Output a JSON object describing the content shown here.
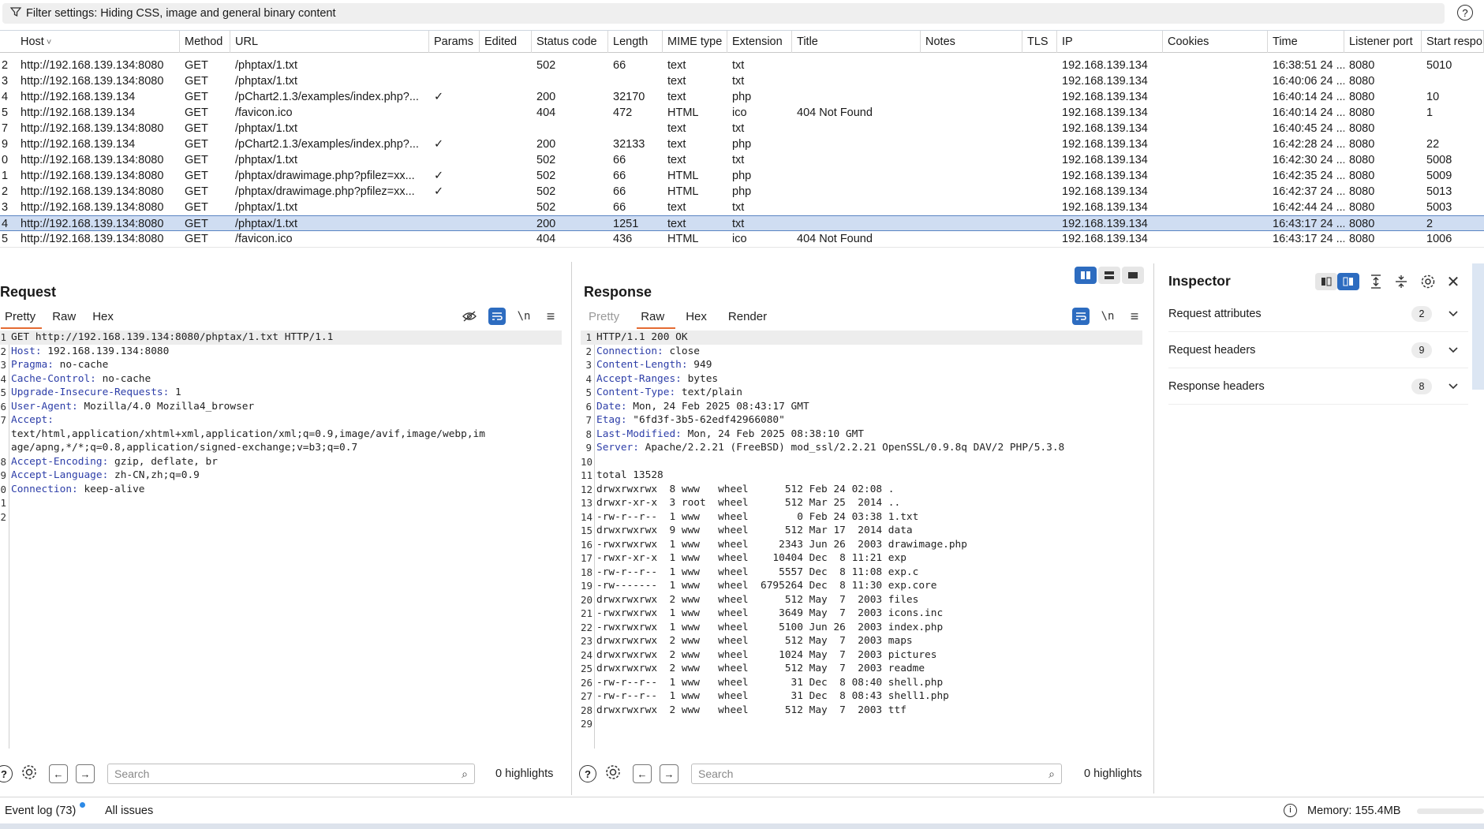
{
  "filter": {
    "text": "Filter settings: Hiding CSS, image and general binary content"
  },
  "table": {
    "columns": [
      {
        "label": "Host",
        "sort": "˅"
      },
      {
        "label": "Method"
      },
      {
        "label": "URL"
      },
      {
        "label": "Params"
      },
      {
        "label": "Edited"
      },
      {
        "label": "Status code"
      },
      {
        "label": "Length"
      },
      {
        "label": "MIME type"
      },
      {
        "label": "Extension"
      },
      {
        "label": "Title"
      },
      {
        "label": "Notes"
      },
      {
        "label": "TLS"
      },
      {
        "label": "IP"
      },
      {
        "label": "Cookies"
      },
      {
        "label": "Time"
      },
      {
        "label": "Listener port"
      },
      {
        "label": "Start respo"
      }
    ],
    "rows": [
      {
        "num": "2",
        "host": "http://192.168.139.134:8080",
        "method": "GET",
        "url": "/phptax/1.txt",
        "params": "",
        "status": "502",
        "length": "66",
        "mime": "text",
        "ext": "txt",
        "title": "",
        "ip": "192.168.139.134",
        "time": "16:38:51 24 ...",
        "port": "8080",
        "start": "5010",
        "selected": false
      },
      {
        "num": "3",
        "host": "http://192.168.139.134:8080",
        "method": "GET",
        "url": "/phptax/1.txt",
        "params": "",
        "status": "",
        "length": "",
        "mime": "text",
        "ext": "txt",
        "title": "",
        "ip": "192.168.139.134",
        "time": "16:40:06 24 ...",
        "port": "8080",
        "start": "",
        "selected": false
      },
      {
        "num": "4",
        "host": "http://192.168.139.134",
        "method": "GET",
        "url": "/pChart2.1.3/examples/index.php?...",
        "params": "✓",
        "status": "200",
        "length": "32170",
        "mime": "text",
        "ext": "php",
        "title": "",
        "ip": "192.168.139.134",
        "time": "16:40:14 24 ...",
        "port": "8080",
        "start": "10",
        "selected": false
      },
      {
        "num": "5",
        "host": "http://192.168.139.134",
        "method": "GET",
        "url": "/favicon.ico",
        "params": "",
        "status": "404",
        "length": "472",
        "mime": "HTML",
        "ext": "ico",
        "title": "404 Not Found",
        "ip": "192.168.139.134",
        "time": "16:40:14 24 ...",
        "port": "8080",
        "start": "1",
        "selected": false
      },
      {
        "num": "7",
        "host": "http://192.168.139.134:8080",
        "method": "GET",
        "url": "/phptax/1.txt",
        "params": "",
        "status": "",
        "length": "",
        "mime": "text",
        "ext": "txt",
        "title": "",
        "ip": "192.168.139.134",
        "time": "16:40:45 24 ...",
        "port": "8080",
        "start": "",
        "selected": false
      },
      {
        "num": "9",
        "host": "http://192.168.139.134",
        "method": "GET",
        "url": "/pChart2.1.3/examples/index.php?...",
        "params": "✓",
        "status": "200",
        "length": "32133",
        "mime": "text",
        "ext": "php",
        "title": "",
        "ip": "192.168.139.134",
        "time": "16:42:28 24 ...",
        "port": "8080",
        "start": "22",
        "selected": false
      },
      {
        "num": "0",
        "host": "http://192.168.139.134:8080",
        "method": "GET",
        "url": "/phptax/1.txt",
        "params": "",
        "status": "502",
        "length": "66",
        "mime": "text",
        "ext": "txt",
        "title": "",
        "ip": "192.168.139.134",
        "time": "16:42:30 24 ...",
        "port": "8080",
        "start": "5008",
        "selected": false
      },
      {
        "num": "1",
        "host": "http://192.168.139.134:8080",
        "method": "GET",
        "url": "/phptax/drawimage.php?pfilez=xx...",
        "params": "✓",
        "status": "502",
        "length": "66",
        "mime": "HTML",
        "ext": "php",
        "title": "",
        "ip": "192.168.139.134",
        "time": "16:42:35 24 ...",
        "port": "8080",
        "start": "5009",
        "selected": false
      },
      {
        "num": "2",
        "host": "http://192.168.139.134:8080",
        "method": "GET",
        "url": "/phptax/drawimage.php?pfilez=xx...",
        "params": "✓",
        "status": "502",
        "length": "66",
        "mime": "HTML",
        "ext": "php",
        "title": "",
        "ip": "192.168.139.134",
        "time": "16:42:37 24 ...",
        "port": "8080",
        "start": "5013",
        "selected": false
      },
      {
        "num": "3",
        "host": "http://192.168.139.134:8080",
        "method": "GET",
        "url": "/phptax/1.txt",
        "params": "",
        "status": "502",
        "length": "66",
        "mime": "text",
        "ext": "txt",
        "title": "",
        "ip": "192.168.139.134",
        "time": "16:42:44 24 ...",
        "port": "8080",
        "start": "5003",
        "selected": false
      },
      {
        "num": "4",
        "host": "http://192.168.139.134:8080",
        "method": "GET",
        "url": "/phptax/1.txt",
        "params": "",
        "status": "200",
        "length": "1251",
        "mime": "text",
        "ext": "txt",
        "title": "",
        "ip": "192.168.139.134",
        "time": "16:43:17 24 ...",
        "port": "8080",
        "start": "2",
        "selected": true
      },
      {
        "num": "5",
        "host": "http://192.168.139.134:8080",
        "method": "GET",
        "url": "/favicon.ico",
        "params": "",
        "status": "404",
        "length": "436",
        "mime": "HTML",
        "ext": "ico",
        "title": "404 Not Found",
        "ip": "192.168.139.134",
        "time": "16:43:17 24 ...",
        "port": "8080",
        "start": "1006",
        "selected": false
      }
    ]
  },
  "request": {
    "title": "Request",
    "tabs": [
      "Pretty",
      "Raw",
      "Hex"
    ],
    "active_tab": "Pretty",
    "lines": [
      {
        "n": "1",
        "name": "",
        "value": "GET http://192.168.139.134:8080/phptax/1.txt HTTP/1.1"
      },
      {
        "n": "2",
        "name": "Host:",
        "value": " 192.168.139.134:8080"
      },
      {
        "n": "3",
        "name": "Pragma:",
        "value": " no-cache"
      },
      {
        "n": "4",
        "name": "Cache-Control:",
        "value": " no-cache"
      },
      {
        "n": "5",
        "name": "Upgrade-Insecure-Requests:",
        "value": " 1"
      },
      {
        "n": "6",
        "name": "User-Agent:",
        "value": " Mozilla/4.0 Mozilla4_browser"
      },
      {
        "n": "7",
        "name": "Accept:",
        "value": ""
      },
      {
        "n": "",
        "name": "",
        "value": "text/html,application/xhtml+xml,application/xml;q=0.9,image/avif,image/webp,im"
      },
      {
        "n": "",
        "name": "",
        "value": "age/apng,*/*;q=0.8,application/signed-exchange;v=b3;q=0.7"
      },
      {
        "n": "8",
        "name": "Accept-Encoding:",
        "value": " gzip, deflate, br"
      },
      {
        "n": "9",
        "name": "Accept-Language:",
        "value": " zh-CN,zh;q=0.9"
      },
      {
        "n": "0",
        "name": "Connection:",
        "value": " keep-alive"
      },
      {
        "n": "1",
        "name": "",
        "value": ""
      },
      {
        "n": "2",
        "name": "",
        "value": ""
      }
    ],
    "search_placeholder": "Search",
    "highlights": "0 highlights"
  },
  "response": {
    "title": "Response",
    "tabs": [
      "Pretty",
      "Raw",
      "Hex",
      "Render"
    ],
    "active_tab": "Raw",
    "lines": [
      {
        "n": "1",
        "name": "",
        "value": "HTTP/1.1 200 OK"
      },
      {
        "n": "2",
        "name": "Connection:",
        "value": " close"
      },
      {
        "n": "3",
        "name": "Content-Length:",
        "value": " 949"
      },
      {
        "n": "4",
        "name": "Accept-Ranges:",
        "value": " bytes"
      },
      {
        "n": "5",
        "name": "Content-Type:",
        "value": " text/plain"
      },
      {
        "n": "6",
        "name": "Date:",
        "value": " Mon, 24 Feb 2025 08:43:17 GMT"
      },
      {
        "n": "7",
        "name": "Etag:",
        "value": " \"6fd3f-3b5-62edf42966080\""
      },
      {
        "n": "8",
        "name": "Last-Modified:",
        "value": " Mon, 24 Feb 2025 08:38:10 GMT"
      },
      {
        "n": "9",
        "name": "Server:",
        "value": " Apache/2.2.21 (FreeBSD) mod_ssl/2.2.21 OpenSSL/0.9.8q DAV/2 PHP/5.3.8"
      },
      {
        "n": "10",
        "name": "",
        "value": ""
      },
      {
        "n": "11",
        "name": "",
        "value": "total 13528"
      },
      {
        "n": "12",
        "name": "",
        "value": "drwxrwxrwx  8 www   wheel      512 Feb 24 02:08 ."
      },
      {
        "n": "13",
        "name": "",
        "value": "drwxr-xr-x  3 root  wheel      512 Mar 25  2014 .."
      },
      {
        "n": "14",
        "name": "",
        "value": "-rw-r--r--  1 www   wheel        0 Feb 24 03:38 1.txt"
      },
      {
        "n": "15",
        "name": "",
        "value": "drwxrwxrwx  9 www   wheel      512 Mar 17  2014 data"
      },
      {
        "n": "16",
        "name": "",
        "value": "-rwxrwxrwx  1 www   wheel     2343 Jun 26  2003 drawimage.php"
      },
      {
        "n": "17",
        "name": "",
        "value": "-rwxr-xr-x  1 www   wheel    10404 Dec  8 11:21 exp"
      },
      {
        "n": "18",
        "name": "",
        "value": "-rw-r--r--  1 www   wheel     5557 Dec  8 11:08 exp.c"
      },
      {
        "n": "19",
        "name": "",
        "value": "-rw-------  1 www   wheel  6795264 Dec  8 11:30 exp.core"
      },
      {
        "n": "20",
        "name": "",
        "value": "drwxrwxrwx  2 www   wheel      512 May  7  2003 files"
      },
      {
        "n": "21",
        "name": "",
        "value": "-rwxrwxrwx  1 www   wheel     3649 May  7  2003 icons.inc"
      },
      {
        "n": "22",
        "name": "",
        "value": "-rwxrwxrwx  1 www   wheel     5100 Jun 26  2003 index.php"
      },
      {
        "n": "23",
        "name": "",
        "value": "drwxrwxrwx  2 www   wheel      512 May  7  2003 maps"
      },
      {
        "n": "24",
        "name": "",
        "value": "drwxrwxrwx  2 www   wheel     1024 May  7  2003 pictures"
      },
      {
        "n": "25",
        "name": "",
        "value": "drwxrwxrwx  2 www   wheel      512 May  7  2003 readme"
      },
      {
        "n": "26",
        "name": "",
        "value": "-rw-r--r--  1 www   wheel       31 Dec  8 08:40 shell.php"
      },
      {
        "n": "27",
        "name": "",
        "value": "-rw-r--r--  1 www   wheel       31 Dec  8 08:43 shell1.php"
      },
      {
        "n": "28",
        "name": "",
        "value": "drwxrwxrwx  2 www   wheel      512 May  7  2003 ttf"
      },
      {
        "n": "29",
        "name": "",
        "value": ""
      }
    ],
    "search_placeholder": "Search",
    "highlights": "0 highlights"
  },
  "inspector": {
    "title": "Inspector",
    "sections": [
      {
        "label": "Request attributes",
        "count": "2"
      },
      {
        "label": "Request headers",
        "count": "9"
      },
      {
        "label": "Response headers",
        "count": "8"
      }
    ]
  },
  "status": {
    "event_log": "Event log (73)",
    "all_issues": "All issues",
    "memory": "Memory: 155.4MB"
  },
  "colors": {
    "accent": "#e46b33",
    "selection": "#cfddf2",
    "header_name": "#2d3ea8",
    "button_blue": "#2d6cc0",
    "event_dot": "#2d8ae6"
  }
}
